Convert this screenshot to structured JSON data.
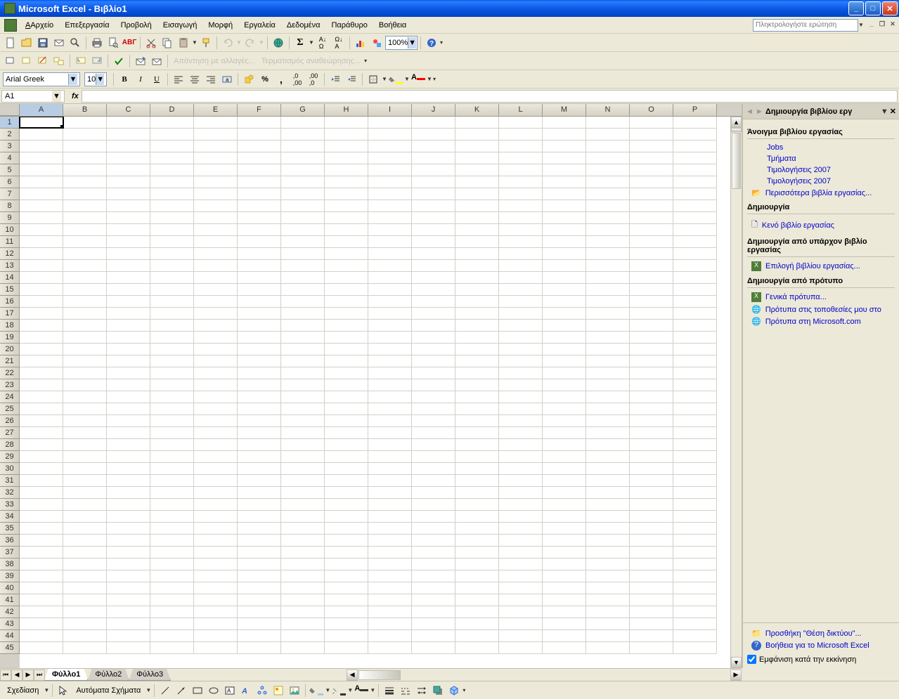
{
  "window": {
    "title": "Microsoft Excel - Βιβλίο1"
  },
  "menubar": {
    "items": [
      "Αρχείο",
      "Επεξεργασία",
      "Προβολή",
      "Εισαγωγή",
      "Μορφή",
      "Εργαλεία",
      "Δεδομένα",
      "Παράθυρο",
      "Βοήθεια"
    ],
    "help_placeholder": "Πληκτρολογήστε ερώτηση"
  },
  "toolbar2": {
    "reply": "Απάντηση με αλλαγές...",
    "end_review": "Τερματισμός αναθεώρησης..."
  },
  "format": {
    "font": "Arial Greek",
    "size": "10",
    "zoom": "100%"
  },
  "namebox": {
    "ref": "A1",
    "fx": "fx"
  },
  "columns": [
    "A",
    "B",
    "C",
    "D",
    "E",
    "F",
    "G",
    "H",
    "I",
    "J",
    "K",
    "L",
    "M",
    "N",
    "O",
    "P"
  ],
  "rows": [
    "1",
    "2",
    "3",
    "4",
    "5",
    "6",
    "7",
    "8",
    "9",
    "10",
    "11",
    "12",
    "13",
    "14",
    "15",
    "16",
    "17",
    "18",
    "19",
    "20",
    "21",
    "22",
    "23",
    "24",
    "25",
    "26",
    "27",
    "28",
    "29",
    "30",
    "31",
    "32",
    "33",
    "34",
    "35",
    "36",
    "37",
    "38",
    "39",
    "40",
    "41",
    "42",
    "43",
    "44",
    "45"
  ],
  "sheets": {
    "tabs": [
      "Φύλλο1",
      "Φύλλο2",
      "Φύλλο3"
    ],
    "active": 0
  },
  "taskpane": {
    "title": "Δημιουργία βιβλίου εργ",
    "open_header": "Άνοιγμα βιβλίου εργασίας",
    "recent": [
      "Jobs",
      "Τμήματα",
      "Τιμολογήσεις 2007",
      "Τιμολογήσεις 2007"
    ],
    "more_workbooks": "Περισσότερα βιβλία εργασίας...",
    "create_header": "Δημιουργία",
    "blank_workbook": "Κενό βιβλίο εργασίας",
    "create_from_existing_header": "Δημιουργία από υπάρχον βιβλίο εργασίας",
    "choose_workbook": "Επιλογή βιβλίου εργασίας...",
    "create_from_template_header": "Δημιουργία από πρότυπο",
    "general_templates": "Γενικά πρότυπα...",
    "my_sites_templates": "Πρότυπα στις τοποθεσίες μου στο",
    "ms_templates": "Πρότυπα στη Microsoft.com",
    "add_network": "Προσθήκη \"Θέση δικτύου\"...",
    "excel_help": "Βοήθεια για το Microsoft Excel",
    "show_startup": "Εμφάνιση κατά την εκκίνηση"
  },
  "drawbar": {
    "draw_label": "Σχεδίαση",
    "autoshapes": "Αυτόματα Σχήματα"
  }
}
